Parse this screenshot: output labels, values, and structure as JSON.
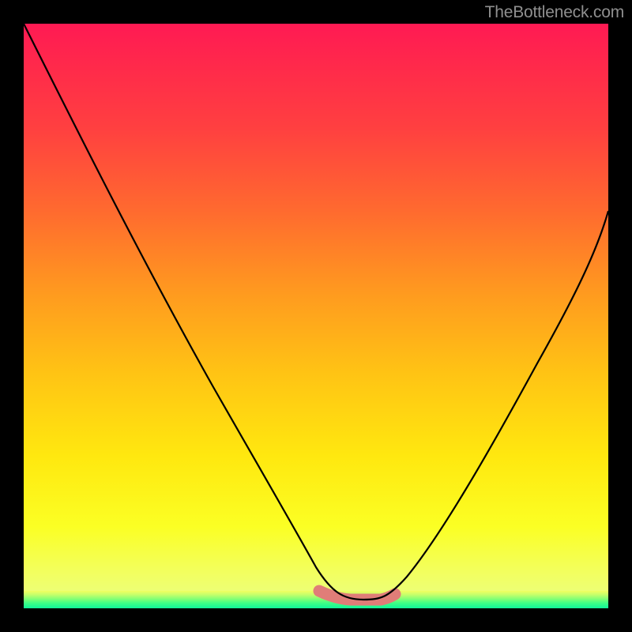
{
  "watermark": "TheBottleneck.com",
  "chart_data": {
    "type": "line",
    "title": "",
    "xlabel": "",
    "ylabel": "",
    "xlim": [
      0,
      100
    ],
    "ylim": [
      0,
      100
    ],
    "series": [
      {
        "name": "bottleneck-curve",
        "x": [
          0,
          5,
          10,
          15,
          20,
          25,
          30,
          35,
          40,
          45,
          50,
          55,
          58,
          60,
          64,
          68,
          72,
          78,
          84,
          90,
          95,
          100
        ],
        "values": [
          100,
          91,
          82,
          72,
          62,
          52,
          42,
          32,
          22,
          13,
          6,
          2,
          0,
          0,
          0,
          2,
          8,
          20,
          34,
          48,
          58,
          68
        ]
      }
    ],
    "highlight_range_x": [
      50.5,
      63.5
    ],
    "gradient_stops": [
      {
        "pos": 0,
        "color": "#ff1a53"
      },
      {
        "pos": 18,
        "color": "#ff4040"
      },
      {
        "pos": 46,
        "color": "#ff9a1f"
      },
      {
        "pos": 74,
        "color": "#ffe80f"
      },
      {
        "pos": 94,
        "color": "#f2ff60"
      },
      {
        "pos": 100,
        "color": "#10f59a"
      }
    ]
  }
}
